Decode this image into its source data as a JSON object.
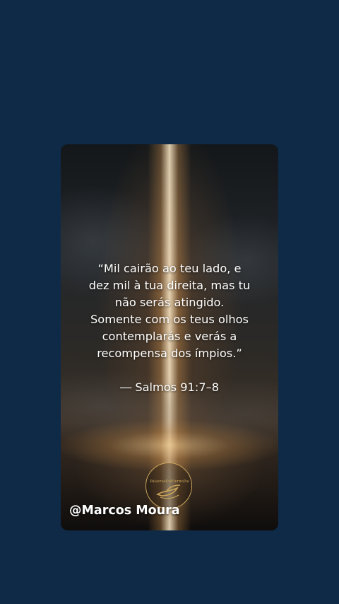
{
  "quote": {
    "text": "“Mil cairão ao teu lado, e\ndez mil à tua direita, mas tu\nnão serás atingido.\nSomente com os teus olhos\ncontemplarás e verás a\nrecompensa dos ímpios.”",
    "reference": "― Salmos 91:7–8"
  },
  "logo": {
    "text": "PalavrasDoEternoPai",
    "icon": "dove-icon"
  },
  "author_handle": "@Marcos Moura",
  "colors": {
    "background": "#0e2a47",
    "text": "#ffffff",
    "logo_gold": "#c9a45a"
  }
}
